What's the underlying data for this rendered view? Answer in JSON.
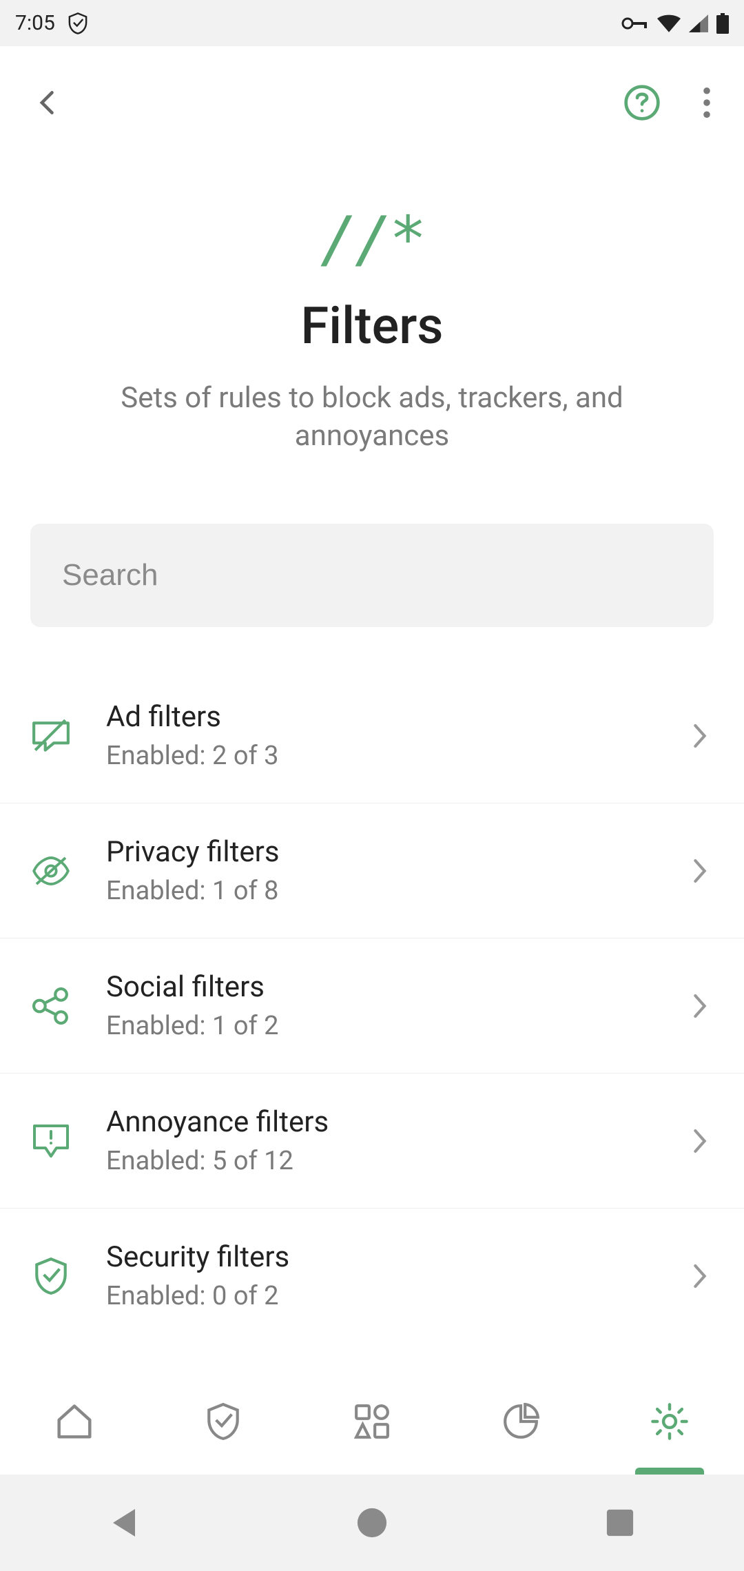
{
  "statusbar": {
    "time": "7:05"
  },
  "header": {
    "logo": "//*",
    "title": "Filters",
    "subtitle": "Sets of rules to block ads, trackers, and annoyances"
  },
  "search": {
    "placeholder": "Search"
  },
  "filters": [
    {
      "title": "Ad filters",
      "sub": "Enabled: 2 of 3",
      "icon": "ad"
    },
    {
      "title": "Privacy filters",
      "sub": "Enabled: 1 of 8",
      "icon": "privacy"
    },
    {
      "title": "Social filters",
      "sub": "Enabled: 1 of 2",
      "icon": "social"
    },
    {
      "title": "Annoyance filters",
      "sub": "Enabled: 5 of 12",
      "icon": "annoyance"
    },
    {
      "title": "Security filters",
      "sub": "Enabled: 0 of 2",
      "icon": "security"
    }
  ],
  "colors": {
    "accent": "#5ba974",
    "muted": "#8a8a8a"
  }
}
